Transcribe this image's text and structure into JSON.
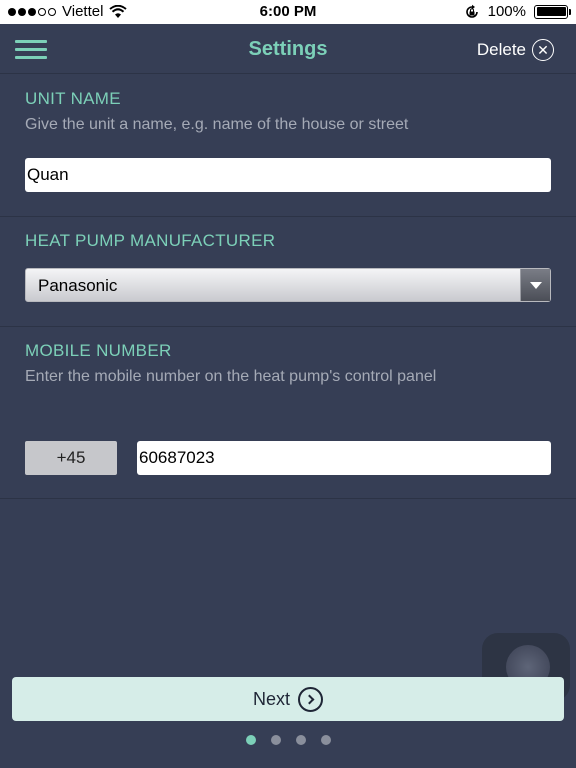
{
  "status_bar": {
    "carrier": "Viettel",
    "time": "6:00 PM",
    "battery": "100%"
  },
  "nav": {
    "title": "Settings",
    "delete_label": "Delete",
    "delete_icon": "close-circle-icon",
    "menu_icon": "hamburger-menu-icon"
  },
  "unit_name": {
    "title": "UNIT NAME",
    "description": "Give the unit a name, e.g. name of the house or street",
    "value": "Quan"
  },
  "manufacturer": {
    "title": "HEAT PUMP MANUFACTURER",
    "selected": "Panasonic"
  },
  "mobile": {
    "title": "MOBILE NUMBER",
    "description": "Enter the mobile number on the heat pump's control panel",
    "country_code": "+45",
    "number": "60687023"
  },
  "footer": {
    "next_label": "Next",
    "next_icon": "chevron-right-circle-icon",
    "page_count": 4,
    "active_page": 1
  },
  "colors": {
    "background": "#363e55",
    "accent": "#7cd0b8",
    "button": "#d6ede8"
  }
}
